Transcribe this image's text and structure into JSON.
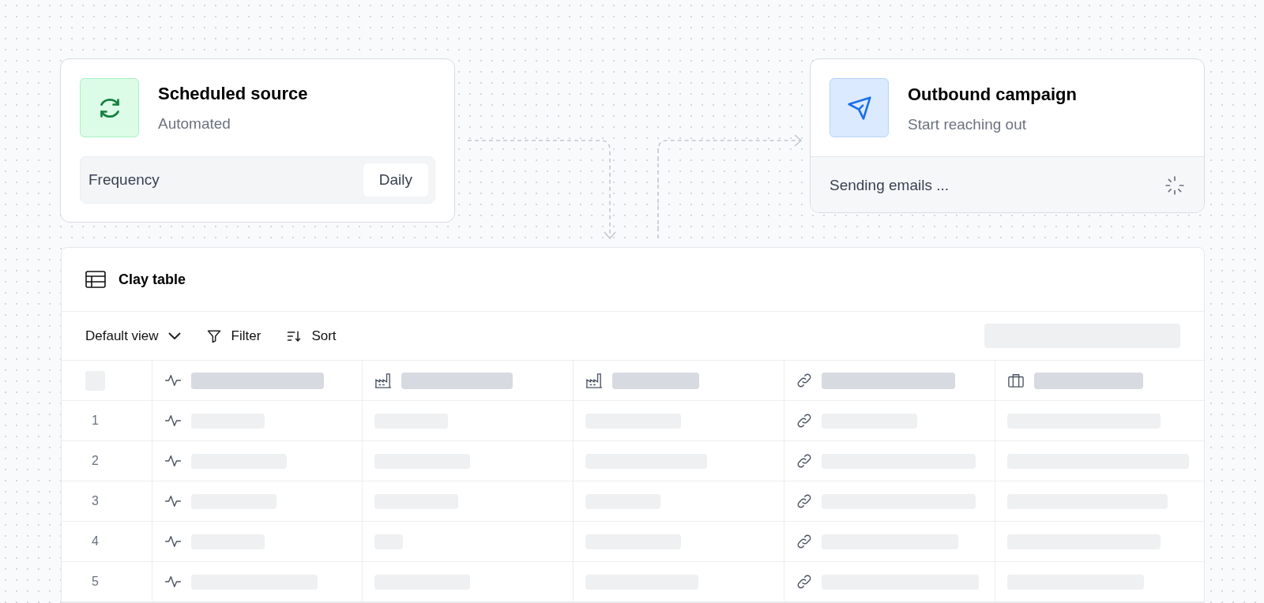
{
  "source_card": {
    "title": "Scheduled source",
    "subtitle": "Automated",
    "setting": {
      "label": "Frequency",
      "value": "Daily"
    }
  },
  "campaign_card": {
    "title": "Outbound campaign",
    "subtitle": "Start reaching out",
    "status": "Sending emails ..."
  },
  "table": {
    "title": "Clay table",
    "toolbar": {
      "view": "Default view",
      "filter": "Filter",
      "sort": "Sort"
    },
    "rows": [
      {
        "number": "1"
      },
      {
        "number": "2"
      },
      {
        "number": "3"
      },
      {
        "number": "4"
      },
      {
        "number": "5"
      }
    ]
  }
}
